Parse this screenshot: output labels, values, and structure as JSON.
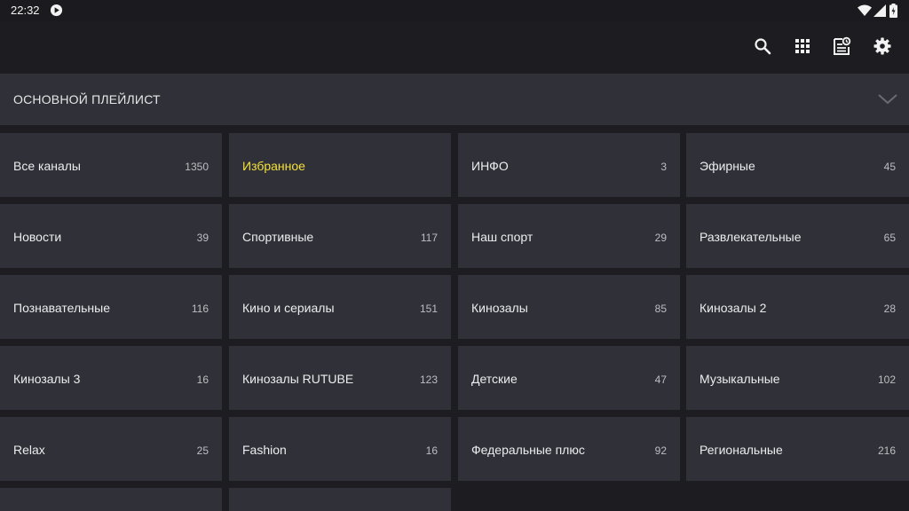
{
  "status_bar": {
    "time": "22:32",
    "icons": [
      "play-notification-icon",
      "wifi-icon",
      "signal-icon",
      "battery-icon"
    ]
  },
  "toolbar": {
    "buttons": [
      "search-icon",
      "grid-icon",
      "epg-icon",
      "settings-icon"
    ]
  },
  "playlist": {
    "title": "ОСНОВНОЙ ПЛЕЙЛИСТ",
    "expand_icon": "chevron-down-icon"
  },
  "categories": [
    {
      "name": "Все каналы",
      "count": "1350"
    },
    {
      "name": "Избранное",
      "count": "",
      "selected": true
    },
    {
      "name": "ИНФО",
      "count": "3"
    },
    {
      "name": "Эфирные",
      "count": "45"
    },
    {
      "name": "Новости",
      "count": "39"
    },
    {
      "name": "Спортивные",
      "count": "117"
    },
    {
      "name": "Наш спорт",
      "count": "29"
    },
    {
      "name": "Развлекательные",
      "count": "65"
    },
    {
      "name": "Познавательные",
      "count": "116"
    },
    {
      "name": "Кино и сериалы",
      "count": "151"
    },
    {
      "name": "Кинозалы",
      "count": "85"
    },
    {
      "name": "Кинозалы 2",
      "count": "28"
    },
    {
      "name": "Кинозалы 3",
      "count": "16"
    },
    {
      "name": "Кинозалы RUTUBE",
      "count": "123"
    },
    {
      "name": "Детские",
      "count": "47"
    },
    {
      "name": "Музыкальные",
      "count": "102"
    },
    {
      "name": "Relax",
      "count": "25"
    },
    {
      "name": "Fashion",
      "count": "16"
    },
    {
      "name": "Федеральные плюс",
      "count": "92"
    },
    {
      "name": "Региональные",
      "count": "216"
    },
    {
      "name": "",
      "count": ""
    },
    {
      "name": "",
      "count": ""
    }
  ],
  "colors": {
    "background": "#1c1c21",
    "tile": "#303038",
    "selected_text": "#f3e13a"
  }
}
